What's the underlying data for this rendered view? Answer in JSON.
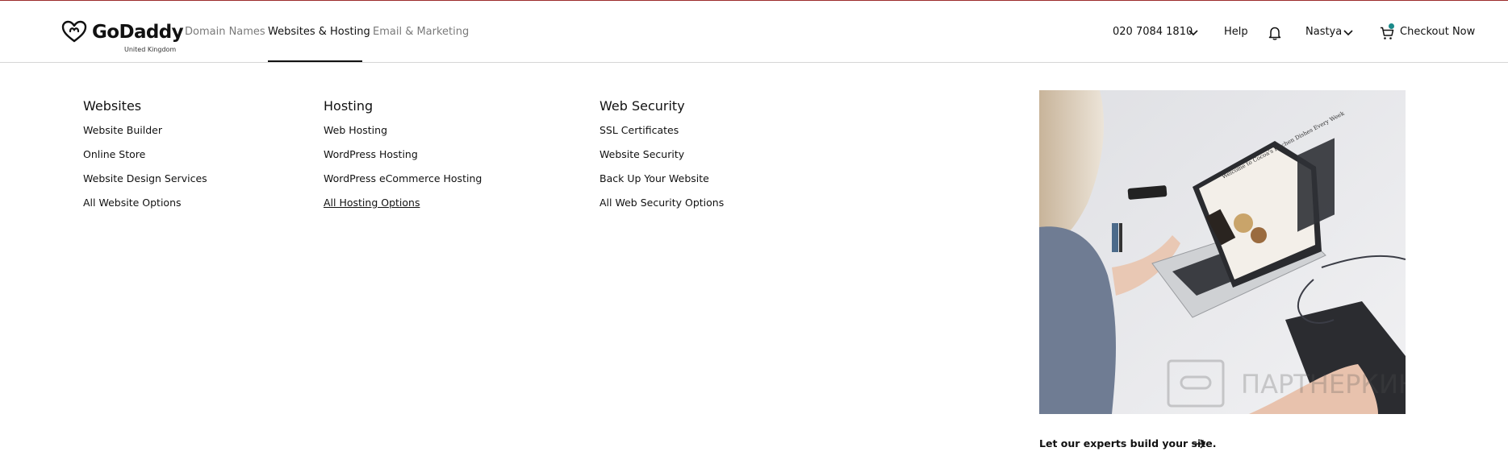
{
  "header": {
    "logo_text": "GoDaddy",
    "logo_region": "United Kingdom",
    "tabs": [
      {
        "label": "Domain Names",
        "active": false
      },
      {
        "label": "Websites & Hosting",
        "active": true
      },
      {
        "label": "Email & Marketing",
        "active": false
      }
    ],
    "phone": "020 7084 1810",
    "help": "Help",
    "user": "Nastya",
    "checkout": "Checkout Now"
  },
  "menu": {
    "websites": {
      "title": "Websites",
      "links": [
        "Website Builder",
        "Online Store",
        "Website Design Services",
        "All Website Options"
      ]
    },
    "hosting": {
      "title": "Hosting",
      "links": [
        "Web Hosting",
        "WordPress Hosting",
        "WordPress eCommerce Hosting",
        "All Hosting Options"
      ]
    },
    "security": {
      "title": "Web Security",
      "links": [
        "SSL Certificates",
        "Website Security",
        "Back Up Your Website",
        "All Web Security Options"
      ]
    }
  },
  "promo": {
    "laptop_screen_text": "Welcome to Cocoa's Kitchen Dishes Every Week",
    "watermark": "ПАРТНЕРКИН",
    "cta": "Let our experts build your site."
  },
  "icons": {
    "logo": "godaddy-heart-logo-icon",
    "phone_dropdown": "chevron-down-icon",
    "notifications": "bell-icon",
    "user_dropdown": "chevron-down-icon",
    "cart": "cart-icon",
    "cta_arrow": "arrow-right-icon"
  },
  "colors": {
    "text": "#111111",
    "muted_tab": "#7a7a7a",
    "cart_badge": "#1a8a8a",
    "top_border": "#9c2b2b"
  }
}
